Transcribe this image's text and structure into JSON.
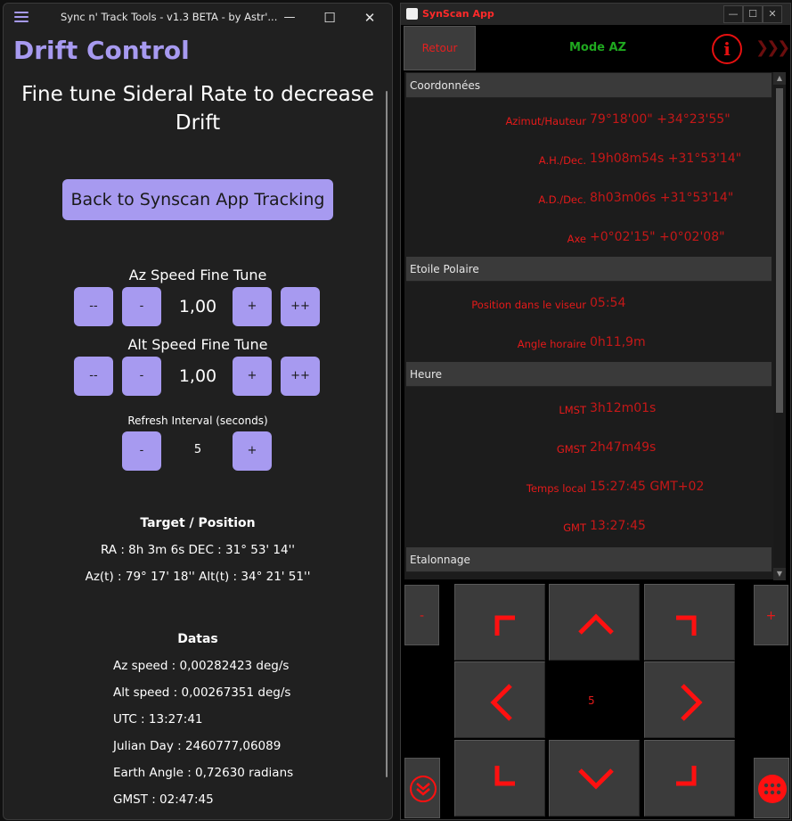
{
  "left_window": {
    "title": "Sync n' Track Tools  - v1.3 BETA - by Astr'...",
    "controls": {
      "minimize": "—",
      "maximize": "☐",
      "close": "✕"
    },
    "page_title": "Drift Control",
    "subtitle_line1": "Fine tune Sideral Rate to decrease",
    "subtitle_line2": "Drift",
    "back_button": "Back to Synscan App Tracking",
    "az": {
      "label": "Az Speed Fine Tune",
      "dec2": "--",
      "dec1": "-",
      "value": "1,00",
      "inc1": "+",
      "inc2": "++"
    },
    "alt": {
      "label": "Alt Speed Fine Tune",
      "dec2": "--",
      "dec1": "-",
      "value": "1,00",
      "inc1": "+",
      "inc2": "++"
    },
    "refresh": {
      "label": "Refresh Interval (seconds)",
      "dec": "-",
      "value": "5",
      "inc": "+"
    },
    "target": {
      "heading": "Target / Position",
      "line1": "RA : 8h 3m 6s   DEC : 31° 53' 14''",
      "line2": "Az(t) : 79° 17' 18''   Alt(t) : 34° 21' 51''"
    },
    "datas": {
      "heading": "Datas",
      "az_speed": "Az speed : 0,00282423 deg/s",
      "alt_speed": "Alt speed : 0,00267351 deg/s",
      "utc": "UTC : 13:27:41",
      "julian": "Julian Day : 2460777,06089",
      "earth": "Earth Angle : 0,72630 radians",
      "gmst": "GMST : 02:47:45"
    }
  },
  "right_window": {
    "title": "SynScan App",
    "controls": {
      "minimize": "—",
      "maximize": "☐",
      "close": "✕"
    },
    "retour": "Retour",
    "mode": "Mode AZ",
    "info_glyph": "i",
    "chevrons": "❯❯❯",
    "sections": {
      "coords": "Coordonnées",
      "polar": "Etoile Polaire",
      "time": "Heure",
      "calib": "Etalonnage"
    },
    "rows": {
      "azalt": {
        "k": "Azimut/Hauteur",
        "v": "79°18'00\" +34°23'55\""
      },
      "ahdec": {
        "k": "A.H./Dec.",
        "v": "19h08m54s +31°53'14\""
      },
      "addec": {
        "k": "A.D./Dec.",
        "v": "8h03m06s +31°53'14\""
      },
      "axe": {
        "k": "Axe",
        "v": "+0°02'15\" +0°02'08\""
      },
      "pos": {
        "k": "Position dans le viseur",
        "v": "05:54"
      },
      "angle": {
        "k": "Angle horaire",
        "v": "0h11,9m"
      },
      "lmst": {
        "k": "LMST",
        "v": "3h12m01s"
      },
      "gmst": {
        "k": "GMST",
        "v": "2h47m49s"
      },
      "local": {
        "k": "Temps local",
        "v": "15:27:45 GMT+02"
      },
      "gmt": {
        "k": "GMT",
        "v": "13:27:45"
      }
    },
    "pad": {
      "minus": "-",
      "plus": "+",
      "rate": "5"
    }
  },
  "colors": {
    "accent": "#a79af0",
    "synscan_red": "#e51a1a",
    "mode_green": "#1fa81f"
  }
}
